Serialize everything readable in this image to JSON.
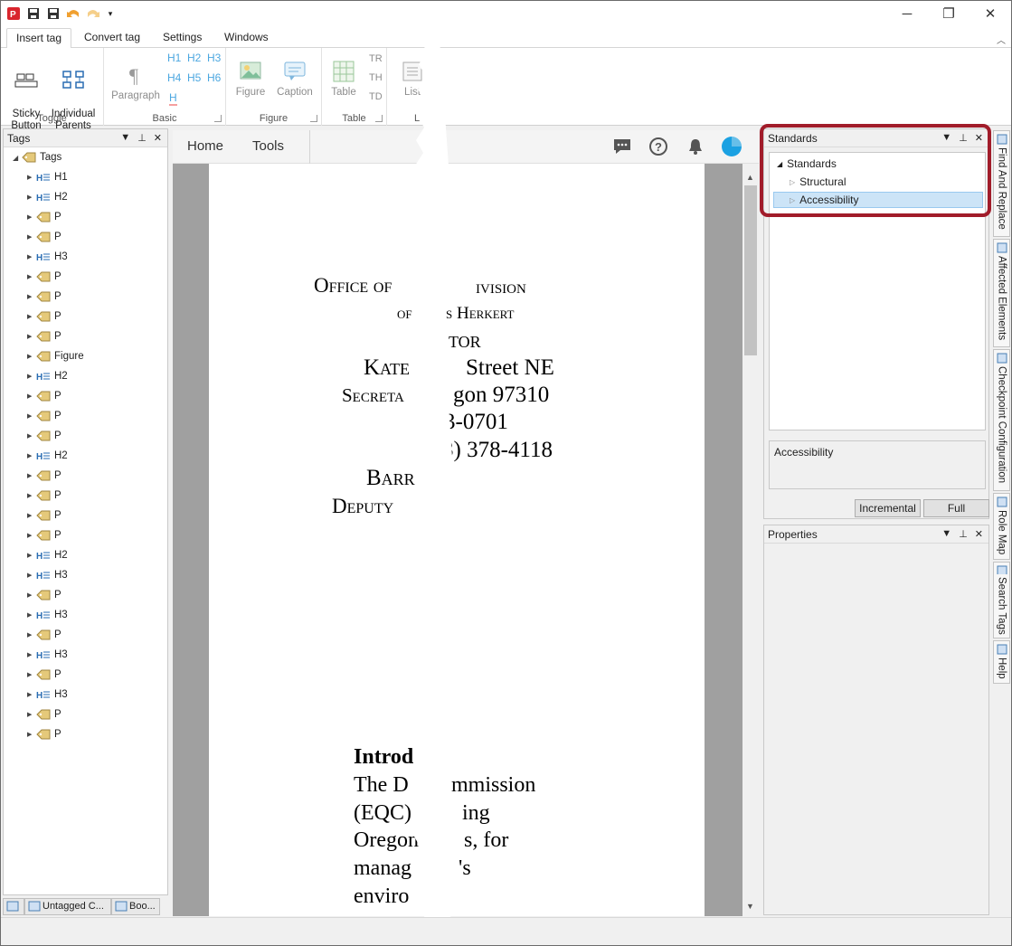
{
  "ribbon_tabs": [
    "Insert tag",
    "Convert tag",
    "Settings",
    "Windows"
  ],
  "ribbon": {
    "toggle": {
      "label": "Toggle",
      "sticky": "Sticky\nButton",
      "parents": "Individual\nParents"
    },
    "basic": {
      "label": "Basic",
      "paragraph": "Paragraph",
      "headings": [
        "H1",
        "H2",
        "H3",
        "H4",
        "H5",
        "H6",
        "H"
      ]
    },
    "figure": {
      "label": "Figure",
      "figure": "Figure",
      "caption": "Caption"
    },
    "table": {
      "label": "Table",
      "table": "Table",
      "cells": [
        "TR",
        "TH",
        "TD"
      ]
    },
    "list": {
      "label": "Lis",
      "list": "List"
    }
  },
  "tags_pane": {
    "title": "Tags",
    "root": "Tags",
    "items": [
      "H1",
      "H2",
      "P",
      "P",
      "H3",
      "P",
      "P",
      "P",
      "P",
      "Figure",
      "H2",
      "P",
      "P",
      "P",
      "H2",
      "P",
      "P",
      "P",
      "P",
      "H2",
      "H3",
      "P",
      "H3",
      "P",
      "H3",
      "P",
      "H3",
      "P",
      "P"
    ],
    "bottom_tabs": [
      "Untagged C...",
      "Boo..."
    ]
  },
  "doc_nav": {
    "home": "Home",
    "tools": "Tools"
  },
  "document": {
    "lines": [
      {
        "text": "Office of",
        "sc": true
      },
      {
        "text": "ivision",
        "sc": true
      },
      {
        "text": "of",
        "sc": true
      },
      {
        "text": "s Herkert",
        "sc": true
      },
      {
        "text": "tor",
        "sc": true
      },
      {
        "text": "Kate",
        "sc": true
      },
      {
        "text": "Street NE"
      },
      {
        "text": "Secreta",
        "sc": true
      },
      {
        "text": "gon 97310"
      },
      {
        "text": "3-0701"
      },
      {
        "text": "3) 378-4118"
      },
      {
        "text": "Barr",
        "sc": true
      },
      {
        "text": "Deputy",
        "sc": true
      },
      {
        "text": "Introd"
      },
      {
        "text": "The D"
      },
      {
        "text": "mmission"
      },
      {
        "text": "(EQC)"
      },
      {
        "text": "ing"
      },
      {
        "text": "Oregon"
      },
      {
        "text": "s, for"
      },
      {
        "text": "manag"
      },
      {
        "text": "'s"
      },
      {
        "text": "enviro"
      }
    ]
  },
  "standards_pane": {
    "title": "Standards",
    "root": "Standards",
    "children": [
      "Structural",
      "Accessibility"
    ],
    "selected": "Accessibility",
    "description": "Accessibility",
    "buttons": [
      "Incremental",
      "Full"
    ]
  },
  "properties_pane": {
    "title": "Properties"
  },
  "vertical_tabs": [
    "Find And Replace",
    "Affected Elements",
    "Checkpoint Configuration",
    "Role Map",
    "Search Tags",
    "Help"
  ],
  "colors": {
    "highlight": "#a11c2a",
    "selection": "#cce4f7",
    "heading_blue": "#4ba7e0"
  }
}
